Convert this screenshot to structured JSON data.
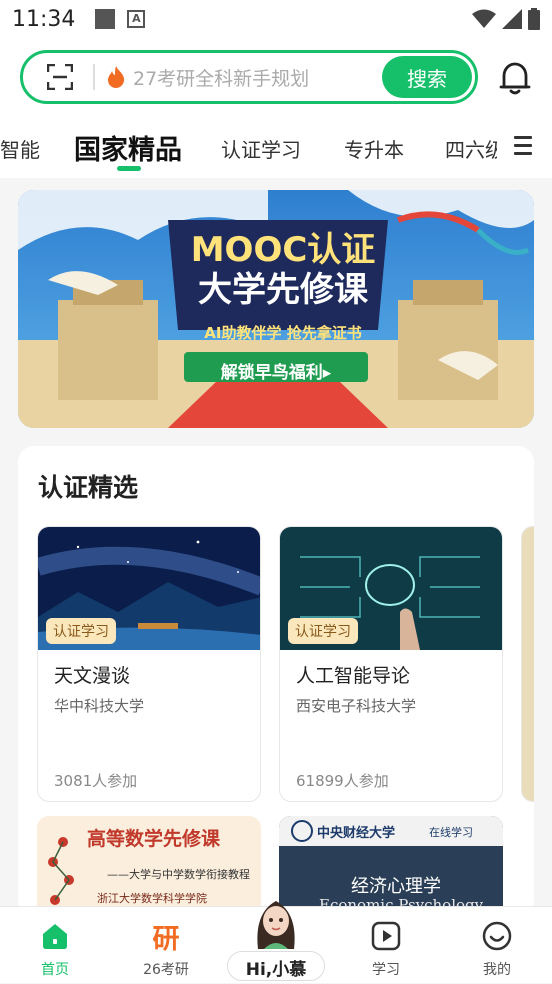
{
  "status_bar": {
    "time": "11:34"
  },
  "search": {
    "placeholder": "27考研全科新手规划",
    "button_label": "搜索"
  },
  "tabs": [
    {
      "label": "智能"
    },
    {
      "label": "国家精品",
      "active": true
    },
    {
      "label": "认证学习"
    },
    {
      "label": "专升本"
    },
    {
      "label": "四六级"
    }
  ],
  "banner": {
    "title_line1": "MOOC认证",
    "title_line2": "大学先修课",
    "subtitle": "AI助教伴学 抢先拿证书",
    "cta": "解锁早鸟福利▸"
  },
  "section": {
    "title": "认证精选",
    "courses": [
      {
        "badge": "认证学习",
        "name": "天文漫谈",
        "school": "华中科技大学",
        "count": "3081人参加"
      },
      {
        "badge": "认证学习",
        "name": "人工智能导论",
        "school": "西安电子科技大学",
        "count": "61899人参加"
      }
    ],
    "more_courses": [
      {
        "title": "高等数学先修课",
        "subtitle": "——大学与中学数学衔接教程",
        "school": "浙江大学数学科学学院"
      },
      {
        "school_header": "中央财经大学",
        "header_right": "在线学习",
        "title": "经济心理学",
        "subtitle": "Economic Psychology"
      }
    ]
  },
  "bottom_nav": [
    {
      "label": "首页",
      "active": true
    },
    {
      "label": "26考研",
      "icon_text": "研"
    },
    {
      "label": "Hi,小慕"
    },
    {
      "label": "学习"
    },
    {
      "label": "我的"
    }
  ],
  "colors": {
    "accent": "#16c06a",
    "badge_bg": "#fbe7bc",
    "orange": "#f26b22"
  }
}
